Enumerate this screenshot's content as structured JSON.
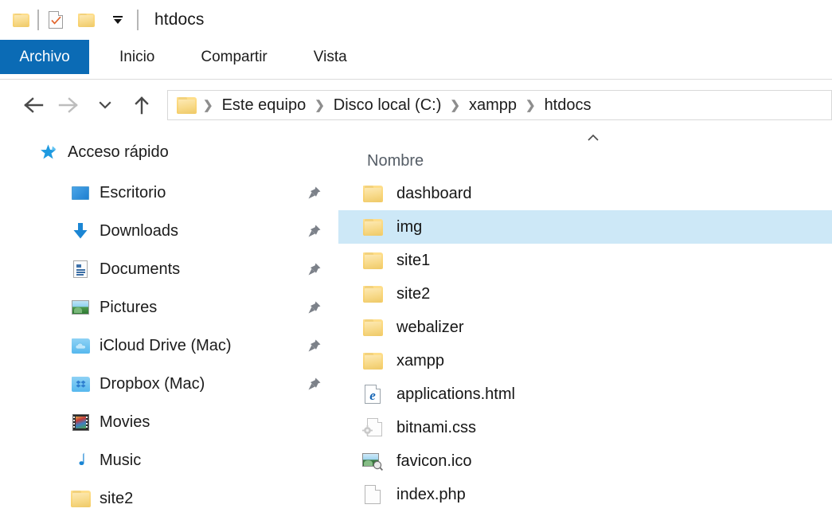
{
  "titlebar": {
    "icons": [
      {
        "name": "folder-icon"
      },
      {
        "name": "separator"
      },
      {
        "name": "properties-checkmark-icon"
      },
      {
        "name": "new-folder-icon"
      },
      {
        "name": "customize-quick-access-toolbar-icon"
      },
      {
        "name": "separator"
      }
    ],
    "title": "htdocs"
  },
  "ribbon": {
    "tabs": [
      {
        "label": "Archivo",
        "active": true
      },
      {
        "label": "Inicio",
        "active": false
      },
      {
        "label": "Compartir",
        "active": false
      },
      {
        "label": "Vista",
        "active": false
      }
    ],
    "active_tab_bg": "#0b6bb5"
  },
  "addressbar": {
    "back_label": "←",
    "forward_label": "→",
    "recent_label": "⌄",
    "up_label": "↑",
    "breadcrumb": [
      {
        "label": "Este equipo"
      },
      {
        "label": "Disco local (C:)"
      },
      {
        "label": "xampp"
      },
      {
        "label": "htdocs"
      }
    ],
    "separator": "❯"
  },
  "sidebar": {
    "items": [
      {
        "label": "Acceso rápido",
        "icon": "star-pin-icon",
        "level": "root",
        "pinned": false
      },
      {
        "label": "Escritorio",
        "icon": "desktop-icon",
        "level": "child",
        "pinned": true
      },
      {
        "label": "Downloads",
        "icon": "download-arrow-icon",
        "level": "child",
        "pinned": true
      },
      {
        "label": "Documents",
        "icon": "document-icon",
        "level": "child",
        "pinned": true
      },
      {
        "label": "Pictures",
        "icon": "pictures-icon",
        "level": "child",
        "pinned": true
      },
      {
        "label": "iCloud Drive (Mac)",
        "icon": "cloud-folder-icon",
        "level": "child",
        "pinned": true
      },
      {
        "label": "Dropbox (Mac)",
        "icon": "dropbox-folder-icon",
        "level": "child",
        "pinned": true
      },
      {
        "label": "Movies",
        "icon": "movies-filmstrip-icon",
        "level": "child",
        "pinned": false
      },
      {
        "label": "Music",
        "icon": "music-note-icon",
        "level": "child",
        "pinned": false
      },
      {
        "label": "site2",
        "icon": "folder-icon",
        "level": "child",
        "pinned": false
      }
    ]
  },
  "filelist": {
    "column_header": "Nombre",
    "sort_indicator": "ascending-chevron-up-icon",
    "selection_color": "#cde8f7",
    "rows": [
      {
        "name": "dashboard",
        "icon": "folder-icon",
        "selected": false
      },
      {
        "name": "img",
        "icon": "folder-icon",
        "selected": true
      },
      {
        "name": "site1",
        "icon": "folder-icon",
        "selected": false
      },
      {
        "name": "site2",
        "icon": "folder-icon",
        "selected": false
      },
      {
        "name": "webalizer",
        "icon": "folder-icon",
        "selected": false
      },
      {
        "name": "xampp",
        "icon": "folder-icon",
        "selected": false
      },
      {
        "name": "applications.html",
        "icon": "edge-html-icon",
        "selected": false
      },
      {
        "name": "bitnami.css",
        "icon": "css-gear-file-icon",
        "selected": false
      },
      {
        "name": "favicon.ico",
        "icon": "image-ico-icon",
        "selected": false
      },
      {
        "name": "index.php",
        "icon": "blank-document-icon",
        "selected": false
      }
    ]
  }
}
